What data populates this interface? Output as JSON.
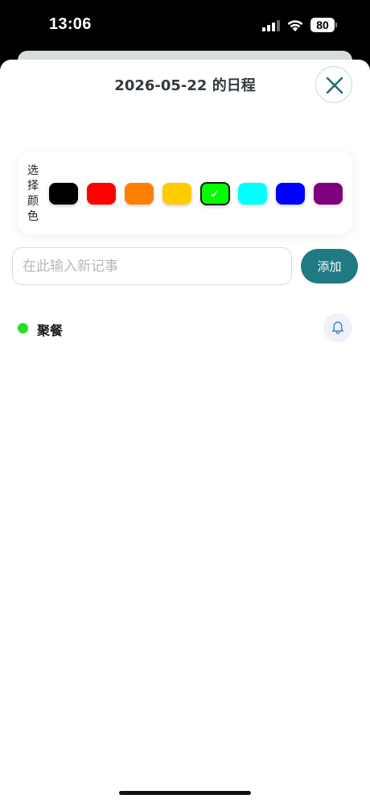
{
  "status_bar": {
    "time": "13:06",
    "battery": "80",
    "icons": [
      "signal-icon",
      "wifi-icon",
      "battery-icon"
    ]
  },
  "sheet": {
    "title": "2026-05-22 的日程",
    "close_icon": "close-icon"
  },
  "color_picker": {
    "label": "选择颜色",
    "swatches": [
      {
        "name": "black",
        "color": "#000000",
        "selected": false
      },
      {
        "name": "red",
        "color": "#ff0000",
        "selected": false
      },
      {
        "name": "orange",
        "color": "#ff7f00",
        "selected": false
      },
      {
        "name": "yellow",
        "color": "#ffcc00",
        "selected": false
      },
      {
        "name": "green",
        "color": "#00ff00",
        "selected": true
      },
      {
        "name": "cyan",
        "color": "#00ffff",
        "selected": false
      },
      {
        "name": "blue",
        "color": "#0000ff",
        "selected": false
      },
      {
        "name": "purple",
        "color": "#7f007f",
        "selected": false
      }
    ],
    "check_glyph": "✓"
  },
  "input": {
    "placeholder": "在此输入新记事",
    "value": ""
  },
  "add_button": {
    "label": "添加",
    "color": "#1f7a83"
  },
  "events": [
    {
      "title": "聚餐",
      "color": "#22e02a",
      "icon": "bell-icon"
    }
  ]
}
